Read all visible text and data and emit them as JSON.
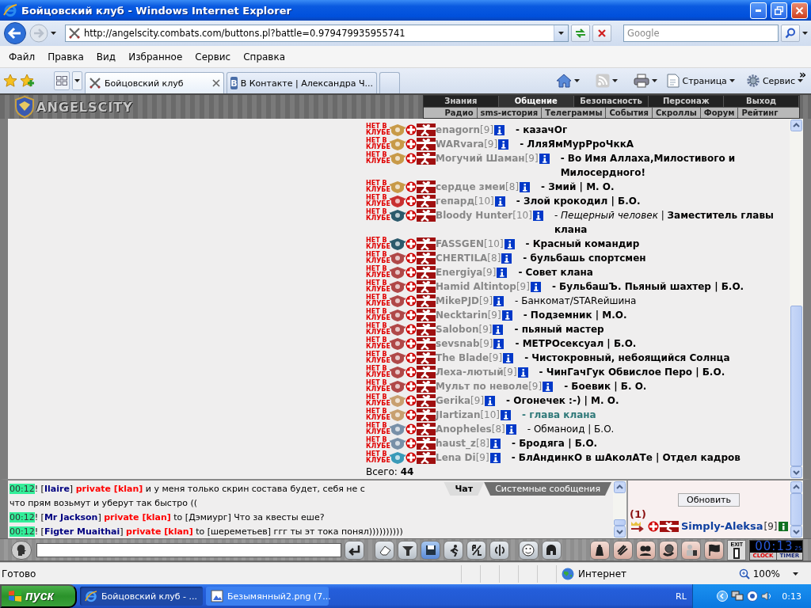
{
  "window": {
    "title": "Бойцовский клуб - Windows Internet Explorer"
  },
  "address_bar": {
    "url": "http://angelscity.combats.com/buttons.pl?battle=0.979479935955741"
  },
  "search": {
    "placeholder": "Google"
  },
  "menu": [
    "Файл",
    "Правка",
    "Вид",
    "Избранное",
    "Сервис",
    "Справка"
  ],
  "tabs": [
    {
      "label": "Бойцовский клуб",
      "selected": true,
      "kind": "game"
    },
    {
      "label": "В Контакте | Александра Ч...",
      "selected": false,
      "kind": "social",
      "letter": "В"
    }
  ],
  "command_bar": {
    "items": [
      "Страница",
      "Сервис"
    ],
    "more": "»"
  },
  "game": {
    "logo": "ANGELSCITY",
    "sections": [
      {
        "label": "Знания",
        "selected": false
      },
      {
        "label": "Общение",
        "selected": true
      },
      {
        "label": "Безопасность",
        "selected": false
      },
      {
        "label": "Персонаж",
        "selected": false
      },
      {
        "label": "Выход",
        "selected": false
      }
    ],
    "links": [
      "Радио",
      "sms-история",
      "Телеграммы",
      "События",
      "Скроллы",
      "Форум",
      "Рейтинг"
    ]
  },
  "members": [
    {
      "club": "НЕТ В КЛУБЕ",
      "color": "#c89a48",
      "name": "enagorn",
      "level": "[9]",
      "status": "- казачОг",
      "kind": "bold"
    },
    {
      "club": "НЕТ В КЛУБЕ",
      "color": "#c89a48",
      "name": "WARvara",
      "level": "[9]",
      "status": "- ЛляЯмМурРроЧккА",
      "kind": "bold"
    },
    {
      "club": "НЕТ В КЛУБЕ",
      "color": "#c89a48",
      "name": "Могучий Шаман",
      "level": "[9]",
      "status": "- Во Имя Аллаха,Милостивого и Милосердного!",
      "kind": "bold"
    },
    {
      "club": "НЕТ В КЛУБЕ",
      "color": "#c89a48",
      "name": "сердце змеи",
      "level": "[8]",
      "status": "- Змий | М. О.",
      "kind": "bold"
    },
    {
      "club": "НЕТ В КЛУБЕ",
      "color": "#c83030",
      "name": "гепард",
      "level": "[10]",
      "status": "- Злой крокодил | Б.О.",
      "kind": "bold"
    },
    {
      "club": "НЕТ В КЛУБЕ",
      "color": "#2c5a6c",
      "name": "Bloody Hunter",
      "level": "[10]",
      "status": "- *Пещерный человек* | **Заместитель главы клана**",
      "kind": "plain"
    },
    {
      "club": "НЕТ В КЛУБЕ",
      "color": "#2c5a6c",
      "name": "FASSGEN",
      "level": "[10]",
      "status": "- Красный командир",
      "kind": "bold"
    },
    {
      "club": "НЕТ В КЛУБЕ",
      "color": "#b04848",
      "name": "CHERTILA",
      "level": "[8]",
      "status": "- бульбашь спортсмен",
      "kind": "bold"
    },
    {
      "club": "НЕТ В КЛУБЕ",
      "color": "#b04848",
      "name": "Energiya",
      "level": "[9]",
      "status": "- Совет клана",
      "kind": "bold"
    },
    {
      "club": "НЕТ В КЛУБЕ",
      "color": "#b04848",
      "name": "Hamid Altintop",
      "level": "[9]",
      "status": "- БульбашЪ. Пьяный шахтер | Б.О.",
      "kind": "bold"
    },
    {
      "club": "НЕТ В КЛУБЕ",
      "color": "#b04848",
      "name": "MikePJD",
      "level": "[9]",
      "status": "- Банкомат/STARейшина",
      "kind": "plain"
    },
    {
      "club": "НЕТ В КЛУБЕ",
      "color": "#b04848",
      "name": "Necktarin",
      "level": "[9]",
      "status": "- Подземник | М.О.",
      "kind": "bold"
    },
    {
      "club": "НЕТ В КЛУБЕ",
      "color": "#b04848",
      "name": "Salobon",
      "level": "[9]",
      "status": "- пьяный мастер",
      "kind": "bold"
    },
    {
      "club": "НЕТ В КЛУБЕ",
      "color": "#b04848",
      "name": "sevsnab",
      "level": "[9]",
      "status": "- МЕТРОсексуал | Б.О.",
      "kind": "bold"
    },
    {
      "club": "НЕТ В КЛУБЕ",
      "color": "#b04848",
      "name": "The Blade",
      "level": "[9]",
      "status": "- Чистокровный, небоящийся Солнца",
      "kind": "bold"
    },
    {
      "club": "НЕТ В КЛУБЕ",
      "color": "#b04848",
      "name": "Леха-лютый",
      "level": "[9]",
      "status": "- ЧинГачГук Обвислое Перо | Б.О.",
      "kind": "bold"
    },
    {
      "club": "НЕТ В КЛУБЕ",
      "color": "#b04848",
      "name": "Мульт по неволе",
      "level": "[9]",
      "status": "- Боевик | Б. О.",
      "kind": "bold"
    },
    {
      "club": "НЕТ В КЛУБЕ",
      "color": "#c8a070",
      "name": "Gerika",
      "level": "[9]",
      "status": "- Огонечек :-) | М. О.",
      "kind": "bold"
    },
    {
      "club": "НЕТ В КЛУБЕ",
      "color": "#c8a070",
      "name": "JIartizan",
      "level": "[10]",
      "status": "- глава клана",
      "kind": "clan-head"
    },
    {
      "club": "НЕТ В КЛУБЕ",
      "color": "#7890a8",
      "name": "Anopheles",
      "level": "[8]",
      "status": "- Обманоид | Б.О.",
      "kind": "plain"
    },
    {
      "club": "НЕТ В КЛУБЕ",
      "color": "#7890a8",
      "name": "haust_z",
      "level": "[8]",
      "status": "- Бродяга | Б.О.",
      "kind": "bold"
    },
    {
      "club": "НЕТ В КЛУБЕ",
      "color": "#3a9ab8",
      "name": "Lena Di",
      "level": "[9]",
      "status": "- БлАндинкО в шАколАТе | Отдел кадров",
      "kind": "bold"
    }
  ],
  "total": {
    "label": "Всего:",
    "count": "44"
  },
  "chat": {
    "tabs": [
      {
        "label": "Чат",
        "selected": true
      },
      {
        "label": "Системные сообщения",
        "selected": false
      }
    ],
    "messages": [
      {
        "segments": [
          {
            "kind": "time",
            "text": "00:12"
          },
          {
            "kind": "plain",
            "text": "! ["
          },
          {
            "kind": "sender",
            "text": "Ilaire"
          },
          {
            "kind": "plain",
            "text": "] "
          },
          {
            "kind": "private",
            "text": "private [klan]"
          },
          {
            "kind": "plain",
            "text": " и у меня только скрин состава будет, себя не с"
          }
        ],
        "continuation": "что прям возьмут и уберут так быстро (("
      },
      {
        "segments": [
          {
            "kind": "time",
            "text": "00:12"
          },
          {
            "kind": "plain",
            "text": "! ["
          },
          {
            "kind": "sender",
            "text": "Mr Jackson"
          },
          {
            "kind": "plain",
            "text": "] "
          },
          {
            "kind": "private",
            "text": "private [klan]"
          },
          {
            "kind": "plain",
            "text": " to [Дэмиург] Что за квесты еше?"
          }
        ]
      },
      {
        "segments": [
          {
            "kind": "time",
            "text": "00:12"
          },
          {
            "kind": "plain",
            "text": "! ["
          },
          {
            "kind": "sender",
            "text": "Figter Muaithai"
          },
          {
            "kind": "plain",
            "text": "] "
          },
          {
            "kind": "private",
            "text": "private [klan]"
          },
          {
            "kind": "plain",
            "text": " to [шереметьев] ггг ты эт тока понял))))))))))"
          }
        ]
      }
    ]
  },
  "online": {
    "refresh": "Обновить",
    "count": "(1)",
    "user": {
      "name": "Simply-Aleksa",
      "level": "[9]"
    }
  },
  "toolbar": {
    "exit": "EXIT",
    "clock": "00:13",
    "seconds": "25",
    "clock_tab": "CLOCK",
    "timer_tab": "TIMER"
  },
  "status_bar": {
    "text": "Готово",
    "zone": "Интернет",
    "zoom": "100%"
  },
  "taskbar": {
    "start": "пуск",
    "tasks": [
      {
        "label": "Бойцовский клуб - ...",
        "selected": true,
        "kind": "browser"
      },
      {
        "label": "Безымянный2.png (7...",
        "selected": false,
        "kind": "image"
      }
    ],
    "language": "RL",
    "time": "0:13"
  }
}
